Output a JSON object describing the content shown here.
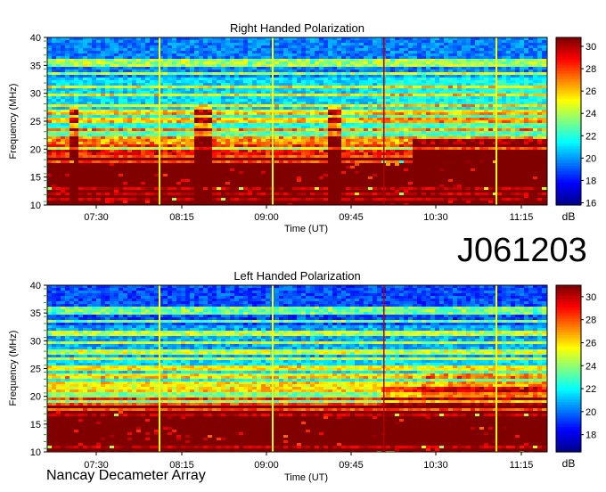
{
  "observation_id": "J061203",
  "instrument": "Nancay Decameter Array",
  "chart_data": [
    {
      "type": "heatmap",
      "title": "Right Handed Polarization",
      "xlabel": "Time (UT)",
      "ylabel": "Frequency (MHz)",
      "x_ticks": [
        "07:30",
        "08:15",
        "09:00",
        "09:45",
        "10:30",
        "11:15"
      ],
      "y_ticks": [
        "10",
        "15",
        "20",
        "25",
        "30",
        "35",
        "40"
      ],
      "ylim": [
        10,
        40
      ],
      "colorbar": {
        "label": "dB",
        "ticks": [
          "16",
          "18",
          "20",
          "22",
          "24",
          "26",
          "28",
          "30"
        ],
        "range": [
          15.8,
          30.8
        ]
      },
      "colormap": [
        "#00008f",
        "#0000ff",
        "#0080ff",
        "#00ffff",
        "#80ff80",
        "#ffff00",
        "#ff8000",
        "#ff0000",
        "#800000"
      ]
    },
    {
      "type": "heatmap",
      "title": "Left Handed Polarization",
      "xlabel": "Time (UT)",
      "ylabel": "Frequency (MHz)",
      "x_ticks": [
        "07:30",
        "08:15",
        "09:00",
        "09:45",
        "10:30",
        "11:15"
      ],
      "y_ticks": [
        "10",
        "15",
        "20",
        "25",
        "30",
        "35",
        "40"
      ],
      "ylim": [
        10,
        40
      ],
      "colorbar": {
        "label": "dB",
        "ticks": [
          "18",
          "20",
          "22",
          "24",
          "26",
          "28",
          "30"
        ],
        "range": [
          16.5,
          31.0
        ]
      },
      "colormap": [
        "#00008f",
        "#0000ff",
        "#0080ff",
        "#00ffff",
        "#80ff80",
        "#ffff00",
        "#ff8000",
        "#ff0000",
        "#800000"
      ]
    }
  ]
}
